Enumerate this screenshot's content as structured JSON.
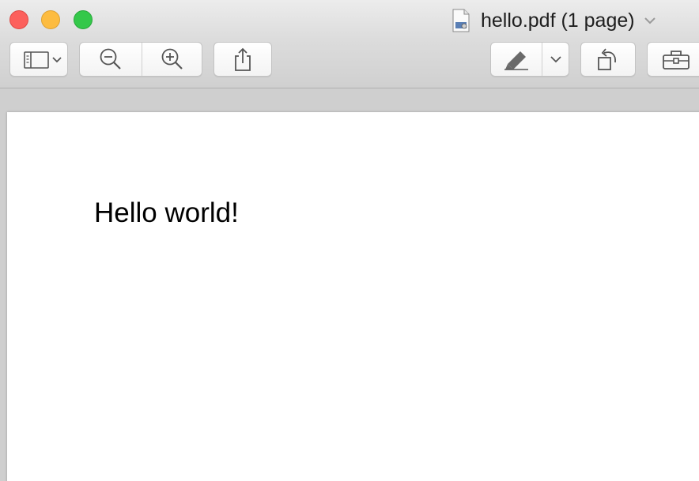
{
  "window": {
    "title": "hello.pdf (1 page)"
  },
  "toolbar": {
    "sidebar_icon": "sidebar-icon",
    "zoom_out_icon": "zoom-out-icon",
    "zoom_in_icon": "zoom-in-icon",
    "share_icon": "share-icon",
    "markup_icon": "pen-icon",
    "rotate_icon": "rotate-left-icon",
    "toolbox_icon": "toolbox-icon"
  },
  "document": {
    "text": "Hello world!"
  },
  "colors": {
    "close": "#fc605c",
    "minimize": "#fdbc40",
    "zoom": "#34c84a"
  }
}
